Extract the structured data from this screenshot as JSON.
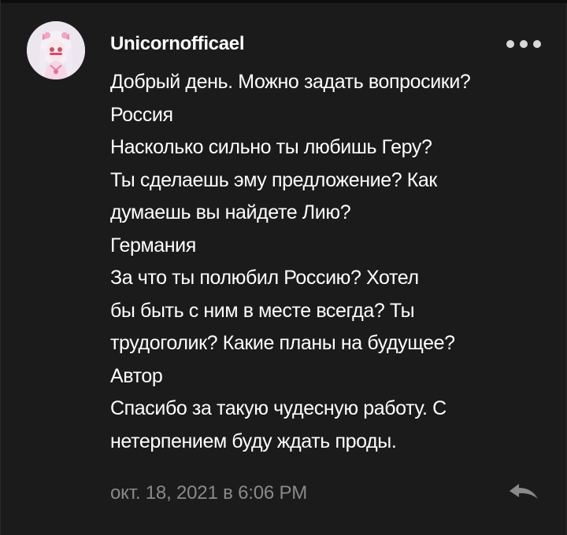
{
  "comment": {
    "author": "Unicornofficael",
    "avatar_icon": "anime-girl-avatar-icon",
    "lines": [
      "Добрый день. Можно задать вопросики?",
      "Россия",
      "Насколько сильно ты любишь Геру?",
      "Ты сделаешь эму предложение? Как",
      "думаешь вы найдете Лию?",
      "Германия",
      "За что ты полюбил Россию? Хотел",
      "бы быть с ним в месте всегда? Ты",
      "трудоголик? Какие планы на будущее?",
      "Автор",
      "Спасибо за такую чудесную работу. С",
      "нетерпением буду ждать проды."
    ],
    "timestamp": "окт. 18, 2021 в 6:06 PM",
    "more_icon": "more-horizontal-icon",
    "reply_icon": "reply-arrow-icon"
  },
  "colors": {
    "background": "#1b1b1c",
    "text": "#ffffff",
    "muted": "#8a8a8a"
  }
}
